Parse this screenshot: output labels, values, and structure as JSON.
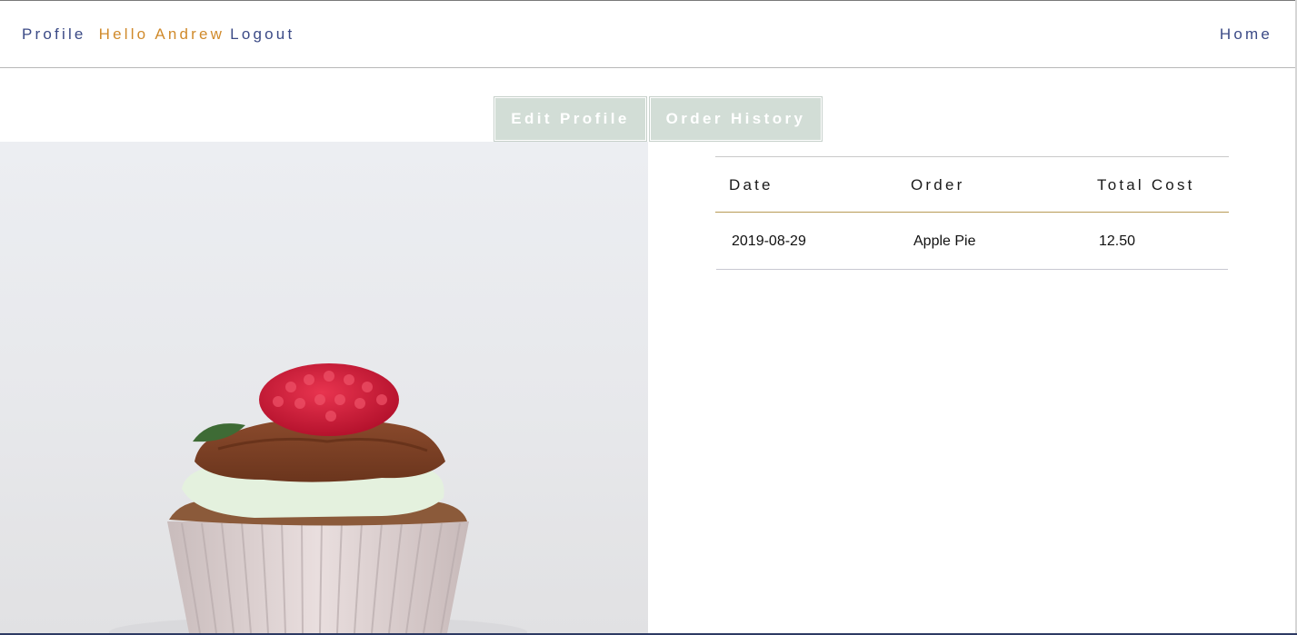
{
  "nav": {
    "profile_label": "Profile",
    "greeting": "Hello Andrew",
    "logout_label": "Logout",
    "home_label": "Home"
  },
  "tabs": [
    {
      "label": "Edit Profile"
    },
    {
      "label": "Order History"
    }
  ],
  "orders": {
    "headers": [
      "Date",
      "Order",
      "Total Cost"
    ],
    "rows": [
      {
        "date": "2019-08-29",
        "order": "Apple Pie",
        "total": "12.50"
      }
    ]
  },
  "colors": {
    "nav_link": "#3b4a86",
    "greeting": "#d08a2b",
    "tab_bg": "#d2ddd6",
    "header_rule": "#b89a55"
  }
}
